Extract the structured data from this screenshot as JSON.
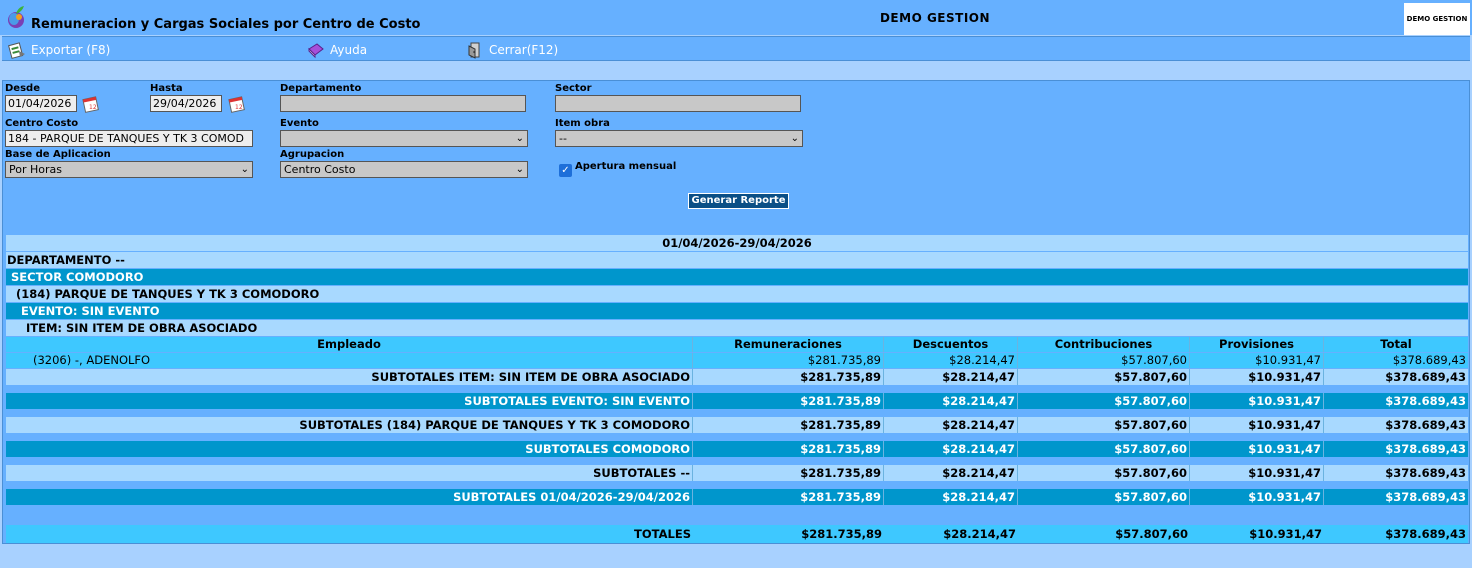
{
  "window": {
    "title": "Remuneracion y Cargas Sociales por Centro de Costo",
    "company": "DEMO GESTION",
    "company_logo_text": "DEMO GESTION"
  },
  "toolbar": {
    "export_label": "Exportar (F8)",
    "help_label": "Ayuda",
    "close_label": "Cerrar(F12)"
  },
  "filters": {
    "desde_label": "Desde",
    "desde_value": "01/04/2026",
    "hasta_label": "Hasta",
    "hasta_value": "29/04/2026",
    "departamento_label": "Departamento",
    "departamento_value": "",
    "sector_label": "Sector",
    "sector_value": "",
    "centro_costo_label": "Centro Costo",
    "centro_costo_value": "184 - PARQUE DE TANQUES Y TK 3 COMOD",
    "evento_label": "Evento",
    "evento_value": "",
    "item_obra_label": "Item obra",
    "item_obra_value": "--",
    "base_label": "Base de Aplicacion",
    "base_value": "Por Horas",
    "agrupacion_label": "Agrupacion",
    "agrupacion_value": "Centro Costo",
    "apertura_label": "Apertura mensual",
    "apertura_checked": true,
    "generate_label": "Generar Reporte"
  },
  "report": {
    "period": "01/04/2026-29/04/2026",
    "departamento": "DEPARTAMENTO --",
    "sector": "SECTOR COMODORO",
    "centro": "(184) PARQUE DE TANQUES Y TK 3 COMODORO",
    "evento": "EVENTO: SIN EVENTO",
    "item": "ITEM: SIN ITEM DE OBRA ASOCIADO",
    "columns": [
      "Empleado",
      "Remuneraciones",
      "Descuentos",
      "Contribuciones",
      "Provisiones",
      "Total"
    ],
    "employee": {
      "name": "(3206) -, ADENOLFO",
      "values": [
        "$281.735,89",
        "$28.214,47",
        "$57.807,60",
        "$10.931,47",
        "$378.689,43"
      ]
    },
    "subtotals": [
      {
        "label": "SUBTOTALES ITEM: SIN ITEM DE OBRA ASOCIADO",
        "values": [
          "$281.735,89",
          "$28.214,47",
          "$57.807,60",
          "$10.931,47",
          "$378.689,43"
        ]
      },
      {
        "label": "SUBTOTALES EVENTO: SIN EVENTO",
        "values": [
          "$281.735,89",
          "$28.214,47",
          "$57.807,60",
          "$10.931,47",
          "$378.689,43"
        ]
      },
      {
        "label": "SUBTOTALES (184) PARQUE DE TANQUES Y TK 3 COMODORO",
        "values": [
          "$281.735,89",
          "$28.214,47",
          "$57.807,60",
          "$10.931,47",
          "$378.689,43"
        ]
      },
      {
        "label": "SUBTOTALES COMODORO",
        "values": [
          "$281.735,89",
          "$28.214,47",
          "$57.807,60",
          "$10.931,47",
          "$378.689,43"
        ]
      },
      {
        "label": "SUBTOTALES --",
        "values": [
          "$281.735,89",
          "$28.214,47",
          "$57.807,60",
          "$10.931,47",
          "$378.689,43"
        ]
      },
      {
        "label": "SUBTOTALES 01/04/2026-29/04/2026",
        "values": [
          "$281.735,89",
          "$28.214,47",
          "$57.807,60",
          "$10.931,47",
          "$378.689,43"
        ]
      }
    ],
    "totals": {
      "label": "TOTALES",
      "values": [
        "$281.735,89",
        "$28.214,47",
        "$57.807,60",
        "$10.931,47",
        "$378.689,43"
      ]
    }
  }
}
